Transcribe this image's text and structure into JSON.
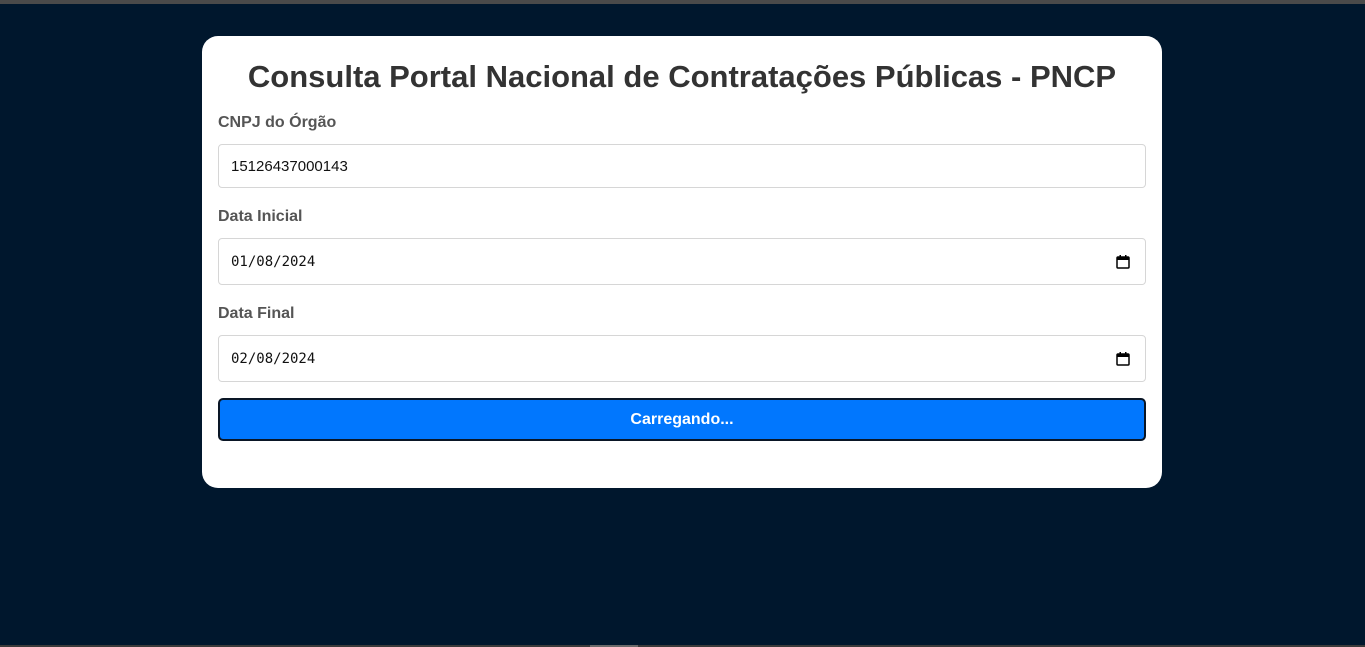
{
  "title": "Consulta Portal Nacional de Contratações Públicas - PNCP",
  "fields": {
    "cnpj": {
      "label": "CNPJ do Órgão",
      "value": "15126437000143"
    },
    "start_date": {
      "label": "Data Inicial",
      "value": "01/08/2024",
      "icon": "calendar-icon"
    },
    "end_date": {
      "label": "Data Final",
      "value": "02/08/2024",
      "icon": "calendar-icon"
    }
  },
  "submit": {
    "label": "Carregando..."
  },
  "colors": {
    "background": "#00172d",
    "card": "#ffffff",
    "title": "#333333",
    "label": "#555555",
    "button": "#0177fe",
    "button_text": "#ffffff"
  }
}
